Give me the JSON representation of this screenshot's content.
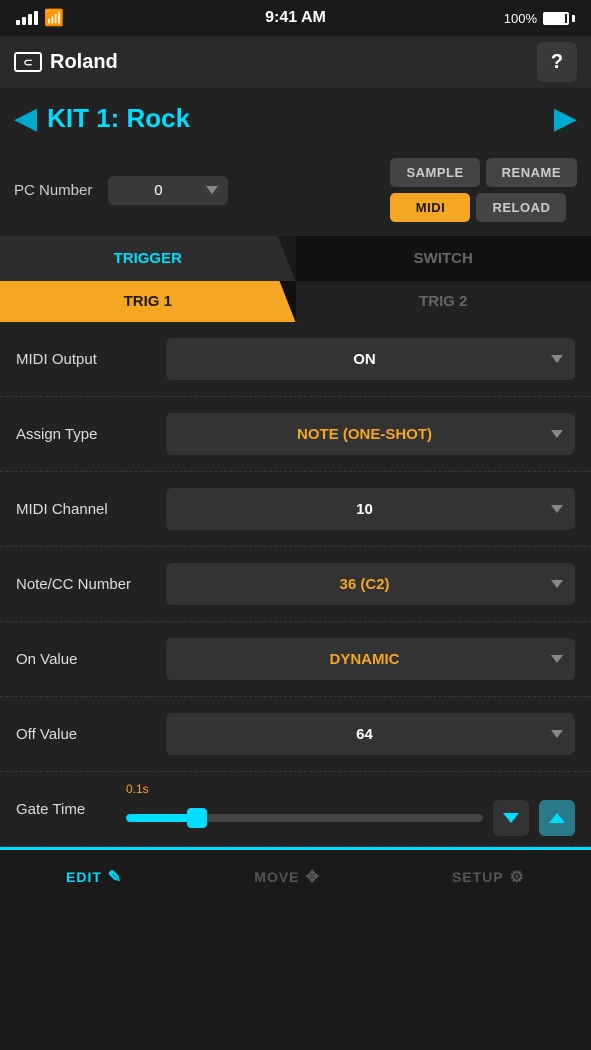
{
  "statusBar": {
    "time": "9:41 AM",
    "battery_pct": "100%"
  },
  "header": {
    "logo": "Roland",
    "help_label": "?"
  },
  "kitNav": {
    "title": "KIT 1: Rock"
  },
  "controls": {
    "pc_label": "PC Number",
    "pc_value": "0",
    "buttons": [
      {
        "label": "SAMPLE",
        "style": "dark"
      },
      {
        "label": "RENAME",
        "style": "dark"
      },
      {
        "label": "MIDI",
        "style": "orange"
      },
      {
        "label": "RELOAD",
        "style": "dark"
      }
    ]
  },
  "tabs": {
    "trigger_label": "TRIGGER",
    "switch_label": "SWITCH",
    "trig1_label": "TRIG 1",
    "trig2_label": "TRIG 2"
  },
  "settings": [
    {
      "label": "MIDI Output",
      "value": "ON",
      "value_color": "white"
    },
    {
      "label": "Assign Type",
      "value": "NOTE (ONE-SHOT)",
      "value_color": "orange"
    },
    {
      "label": "MIDI Channel",
      "value": "10",
      "value_color": "white"
    },
    {
      "label": "Note/CC Number",
      "value": "36 (C2)",
      "value_color": "orange"
    },
    {
      "label": "On Value",
      "value": "DYNAMIC",
      "value_color": "orange"
    },
    {
      "label": "Off Value",
      "value": "64",
      "value_color": "white"
    }
  ],
  "gateTime": {
    "label": "Gate Time",
    "value_label": "0.1s",
    "slider_pct": 20
  },
  "bottomNav": {
    "edit_label": "EDIT",
    "move_label": "MOVE",
    "setup_label": "SETUP"
  }
}
